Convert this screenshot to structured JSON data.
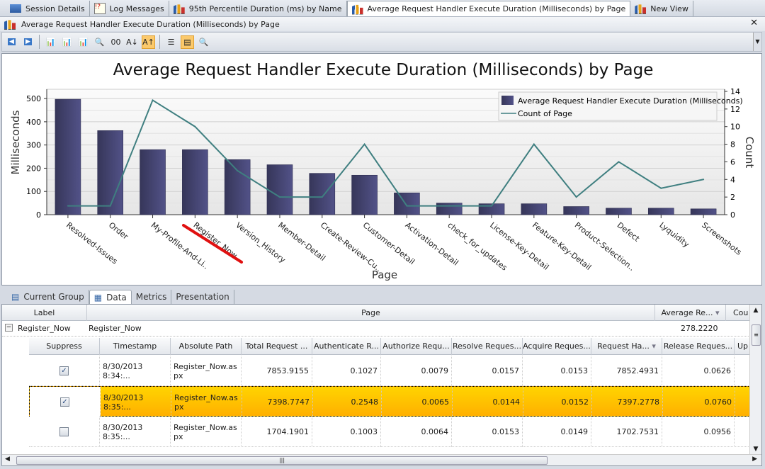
{
  "doc_tabs": [
    {
      "label": "Session Details",
      "icon": "monitor-icon"
    },
    {
      "label": "Log Messages",
      "icon": "log-icon"
    },
    {
      "label": "95th Percentile Duration (ms) by Name",
      "icon": "bar-chart-icon"
    },
    {
      "label": "Average Request Handler Execute Duration (Milliseconds) by Page",
      "icon": "bar-chart-icon",
      "active": true
    },
    {
      "label": "New View",
      "icon": "bar-chart-icon"
    }
  ],
  "view_title": "Average Request Handler Execute Duration (Milliseconds) by Page",
  "toolbar": {
    "buttons": [
      {
        "name": "back",
        "glyph": "◀"
      },
      {
        "name": "forward",
        "glyph": "▶"
      },
      {
        "name": "add-chart",
        "glyph": "📊"
      },
      {
        "name": "remove-chart",
        "glyph": "📊"
      },
      {
        "name": "edit-chart",
        "glyph": "📊"
      },
      {
        "name": "zoom-chart",
        "glyph": "🔍"
      },
      {
        "name": "values",
        "glyph": "00"
      },
      {
        "name": "sort-ascending",
        "glyph": "A↓"
      },
      {
        "name": "sort-descending",
        "glyph": "A↑",
        "active": true
      },
      {
        "name": "layout",
        "glyph": "☰"
      },
      {
        "name": "properties",
        "glyph": "▤",
        "active": true
      },
      {
        "name": "print-preview",
        "glyph": "🔍"
      }
    ]
  },
  "chart_data": {
    "type": "bar",
    "title": "Average Request Handler Execute Duration (Milliseconds) by Page",
    "xlabel": "Page",
    "ylabel": "Milliseconds",
    "y2label": "Count",
    "categories": [
      "Resolved-Issues",
      "Order",
      "My-Profile-And-Li..",
      "Register_Now",
      "Version_History",
      "Member-Detail",
      "Create-Review-Cu..",
      "Customer-Detail",
      "Activation-Detail",
      "check_for_updates",
      "License-Key-Detail",
      "Feature-Key-Detail",
      "Product-Selection..",
      "Defect",
      "Lyquidity",
      "Screenshots"
    ],
    "series": [
      {
        "name": "Average Request Handler Execute Duration (Milliseconds)",
        "type": "bar",
        "axis": "left",
        "color": "#4a4a7c",
        "values": [
          497,
          362,
          280,
          280,
          237,
          215,
          178,
          170,
          94,
          50,
          47,
          47,
          35,
          28,
          28,
          25
        ]
      },
      {
        "name": "Count of Page",
        "type": "line",
        "axis": "right",
        "color": "#3f7f80",
        "values": [
          1,
          1,
          13,
          10,
          5,
          2,
          2,
          8,
          1,
          1,
          1,
          8,
          2,
          6,
          3,
          4
        ]
      }
    ],
    "ylim": [
      0,
      540
    ],
    "yticks": [
      0,
      100,
      200,
      300,
      400,
      500
    ],
    "y2lim": [
      0,
      14
    ],
    "y2ticks": [
      0,
      2,
      4,
      6,
      8,
      10,
      12,
      14
    ],
    "grid": true,
    "legend": "top-right",
    "annotation": "red strike line under Register_Now"
  },
  "bottom_tabs": [
    {
      "label": "Current Group"
    },
    {
      "label": "Data",
      "active": true
    },
    {
      "label": "Metrics"
    },
    {
      "label": "Presentation"
    }
  ],
  "grid": {
    "group_headers": [
      "Label",
      "Page",
      "Average Re...",
      "Cou"
    ],
    "group_row": {
      "label": "Register_Now",
      "page": "Register_Now",
      "average": "278.2220"
    },
    "columns": [
      "Suppress",
      "Timestamp",
      "Absolute Path",
      "Total Request ...",
      "Authenticate R...",
      "Authorize Requ...",
      "Resolve Reques...",
      "Acquire Reques...",
      "Request Ha...",
      "Release Reques...",
      "Up"
    ],
    "rows": [
      {
        "suppress": true,
        "cells": [
          "8/30/2013 8:34:...",
          "Register_Now.aspx",
          "7853.9155",
          "0.1027",
          "0.0079",
          "0.0157",
          "0.0153",
          "7852.4931",
          "0.0626"
        ]
      },
      {
        "suppress": true,
        "selected": true,
        "cells": [
          "8/30/2013 8:35:...",
          "Register_Now.aspx",
          "7398.7747",
          "0.2548",
          "0.0065",
          "0.0144",
          "0.0152",
          "7397.2778",
          "0.0760"
        ]
      },
      {
        "suppress": false,
        "cells": [
          "8/30/2013 8:35:...",
          "Register_Now.aspx",
          "1704.1901",
          "0.1003",
          "0.0064",
          "0.0153",
          "0.0149",
          "1702.7531",
          "0.0956"
        ]
      }
    ]
  }
}
